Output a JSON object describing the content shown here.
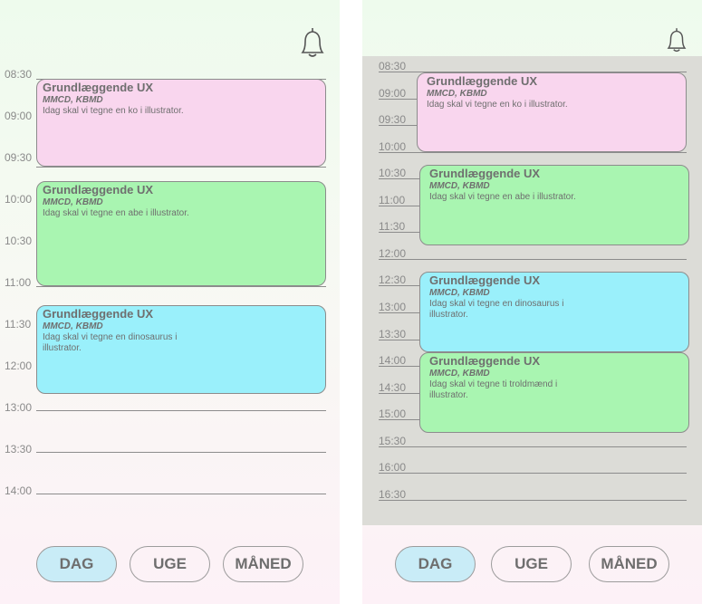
{
  "colors": {
    "event_pink": "#f9d6ee",
    "event_green": "#a9f5b1",
    "event_cyan": "#9af0fb",
    "active_tab": "#c9ecf7",
    "right_panel_bg": "#dcdcd7"
  },
  "icons": {
    "notifications": "bell-icon"
  },
  "left": {
    "times": [
      "08:30",
      "09:00",
      "09:30",
      "10:00",
      "10:30",
      "11:00",
      "11:30",
      "12:00",
      "13:00",
      "13:30",
      "14:00"
    ],
    "events": [
      {
        "title": "Grundlæggende UX",
        "subtitle": "MMCD, KBMD",
        "desc": "Idag skal vi tegne en ko i illustrator.",
        "color": "#f9d6ee"
      },
      {
        "title": "Grundlæggende UX",
        "subtitle": "MMCD, KBMD",
        "desc": "Idag skal vi tegne en abe i illustrator.",
        "color": "#a9f5b1"
      },
      {
        "title": "Grundlæggende UX",
        "subtitle": "MMCD, KBMD",
        "desc": "Idag skal vi tegne en dinosaurus i illustrator.",
        "color": "#9af0fb"
      }
    ],
    "tabs": [
      "DAG",
      "UGE",
      "MÅNED"
    ],
    "active_tab": "DAG"
  },
  "right": {
    "times": [
      "08:30",
      "09:00",
      "09:30",
      "10:00",
      "10:30",
      "11:00",
      "11:30",
      "12:00",
      "12:30",
      "13:00",
      "13:30",
      "14:00",
      "14:30",
      "15:00",
      "15:30",
      "16:00",
      "16:30"
    ],
    "events": [
      {
        "title": "Grundlæggende UX",
        "subtitle": "MMCD, KBMD",
        "desc": "Idag skal vi tegne en ko i illustrator.",
        "color": "#f9d6ee"
      },
      {
        "title": "Grundlæggende UX",
        "subtitle": "MMCD, KBMD",
        "desc": "Idag skal vi tegne en abe i illustrator.",
        "color": "#a9f5b1"
      },
      {
        "title": "Grundlæggende UX",
        "subtitle": "MMCD, KBMD",
        "desc": "Idag skal vi tegne en dinosaurus i illustrator.",
        "color": "#9af0fb"
      },
      {
        "title": "Grundlæggende UX",
        "subtitle": "MMCD, KBMD",
        "desc": "Idag skal vi tegne ti troldmænd i illustrator.",
        "color": "#a9f5b1"
      }
    ],
    "tabs": [
      "DAG",
      "UGE",
      "MÅNED"
    ],
    "active_tab": "DAG"
  }
}
